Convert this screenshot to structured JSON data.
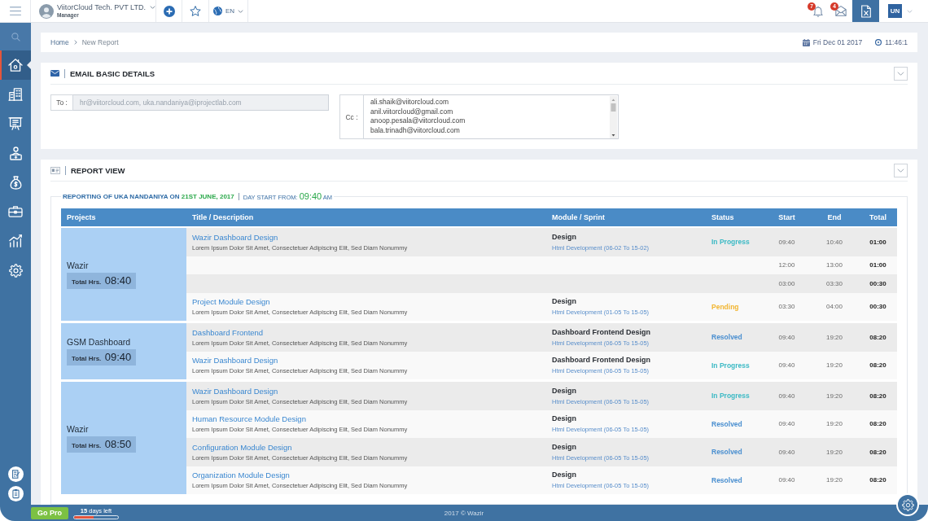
{
  "topbar": {
    "company": "ViitorCloud Tech. PVT LTD.",
    "role": "Manager",
    "language": "EN",
    "notification_count": "7",
    "message_count": "4",
    "user_initials": "UN"
  },
  "sidebar": {
    "items": [
      {
        "selected": true
      },
      {
        "selected": false
      },
      {
        "selected": false
      },
      {
        "selected": false
      },
      {
        "selected": false
      },
      {
        "selected": false
      },
      {
        "selected": false
      },
      {
        "selected": false
      }
    ]
  },
  "breadcrumb": {
    "items": [
      "Home",
      "New Report"
    ],
    "date": "Fri Dec 01 2017",
    "time": "11:46:1"
  },
  "email_panel": {
    "title": "EMAIL BASIC DETAILS",
    "to": {
      "label": "To :",
      "value": "hr@viitorcloud.com, uka.nandaniya@iprojectlab.com"
    },
    "cc": {
      "label": "Cc :",
      "values": [
        "ali.shaik@viitorcloud.com",
        "anil.viitorcloud@gmail.com",
        "anoop.pesala@viitorcloud.com",
        "bala.trinadh@viitorcloud.com"
      ]
    }
  },
  "report_panel": {
    "title": "REPORT VIEW",
    "heading": {
      "text": "REPORTING OF UKA NANDANIYA ON",
      "date": "21ST JUNE, 2017"
    },
    "day_start": {
      "label": "DAY START FROM:",
      "time": "09:40",
      "suffix": "AM"
    },
    "table": {
      "columns": [
        "Projects",
        "Title / Description",
        "Module / Sprint",
        "Status",
        "Start",
        "End",
        "Total"
      ],
      "groups": [
        {
          "project": "Wazir",
          "total_label": "Total Hrs.",
          "total": "08:40",
          "rows": [
            {
              "kind": "task",
              "title": "Wazir Dashboard Design",
              "description": "Lorem Ipsum Dolor Sit Amet, Consectetuer Adipiscing Elit, Sed Diam Nonummy",
              "module": "Design",
              "sprint": "Html Development (06-02 To 15-02)",
              "status": {
                "text": "In Progress",
                "color": "#3dbac5"
              },
              "start": "09:40",
              "end": "10:40",
              "total": "01:00"
            },
            {
              "kind": "time_slot",
              "start": "12:00",
              "end": "13:00",
              "total": "01:00"
            },
            {
              "kind": "time_slot",
              "start": "03:00",
              "end": "03:30",
              "total": "00:30"
            },
            {
              "kind": "task",
              "title": "Project Module Design",
              "description": "Lorem Ipsum Dolor Sit Amet, Consectetuer Adipiscing Elit, Sed Diam Nonummy",
              "module": "Design",
              "sprint": "Html Development (01-05 To 15-05)",
              "status": {
                "text": "Pending",
                "color": "#f2b632"
              },
              "start": "03:30",
              "end": "04:00",
              "total": "00:30"
            }
          ]
        },
        {
          "project": "GSM Dashboard",
          "total_label": "Total Hrs.",
          "total": "09:40",
          "rows": [
            {
              "kind": "task",
              "title": "Dashboard Frontend",
              "description": "Lorem Ipsum Dolor Sit Amet, Consectetuer Adipiscing Elit, Sed Diam Nonummy",
              "module": "Dashboard Frontend Design",
              "sprint": "Html Development (06-05 To 15-05)",
              "status": {
                "text": "Resolved",
                "color": "#4a8fd0"
              },
              "start": "09:40",
              "end": "19:20",
              "total": "08:20"
            },
            {
              "kind": "task",
              "title": "Wazir Dashboard Design",
              "description": "Lorem Ipsum Dolor Sit Amet, Consectetuer Adipiscing Elit, Sed Diam Nonummy",
              "module": "Dashboard Frontend Design",
              "sprint": "Html Development (06-05 To 15-05)",
              "status": {
                "text": "In Progress",
                "color": "#3dbac5"
              },
              "start": "09:40",
              "end": "19:20",
              "total": "08:20"
            }
          ]
        },
        {
          "project": "Wazir",
          "total_label": "Total Hrs.",
          "total": "08:50",
          "rows": [
            {
              "kind": "task",
              "title": "Wazir Dashboard Design",
              "description": "Lorem Ipsum Dolor Sit Amet, Consectetuer Adipiscing Elit, Sed Diam Nonummy",
              "module": "Design",
              "sprint": "Html Development (06-05 To 15-05)",
              "status": {
                "text": "In Progress",
                "color": "#3dbac5"
              },
              "start": "09:40",
              "end": "19:20",
              "total": "08:20"
            },
            {
              "kind": "task",
              "title": "Human Resource Module Design",
              "description": "Lorem Ipsum Dolor Sit Amet, Consectetuer Adipiscing Elit, Sed Diam Nonummy",
              "module": "Design",
              "sprint": "Html Development (06-05 To 15-05)",
              "status": {
                "text": "Resolved",
                "color": "#4a8fd0"
              },
              "start": "09:40",
              "end": "19:20",
              "total": "08:20"
            },
            {
              "kind": "task",
              "title": "Configuration Module Design",
              "description": "Lorem Ipsum Dolor Sit Amet, Consectetuer Adipiscing Elit, Sed Diam Nonummy",
              "module": "Design",
              "sprint": "Html Development (06-05 To 15-05)",
              "status": {
                "text": "Resolved",
                "color": "#4a8fd0"
              },
              "start": "09:40",
              "end": "19:20",
              "total": "08:20"
            },
            {
              "kind": "task",
              "title": "Organization Module Design",
              "description": "Lorem Ipsum Dolor Sit Amet, Consectetuer Adipiscing Elit, Sed Diam Nonummy",
              "module": "Design",
              "sprint": "Html Development (06-05 To 15-05)",
              "status": {
                "text": "Resolved",
                "color": "#4a8fd0"
              },
              "start": "09:40",
              "end": "19:20",
              "total": "08:20"
            }
          ]
        }
      ]
    }
  },
  "footer": {
    "upgrade_button": "Go Pro",
    "trial": {
      "text": "**15** days left",
      "level": 0.45
    },
    "copyright": "2017 © Wazir"
  }
}
